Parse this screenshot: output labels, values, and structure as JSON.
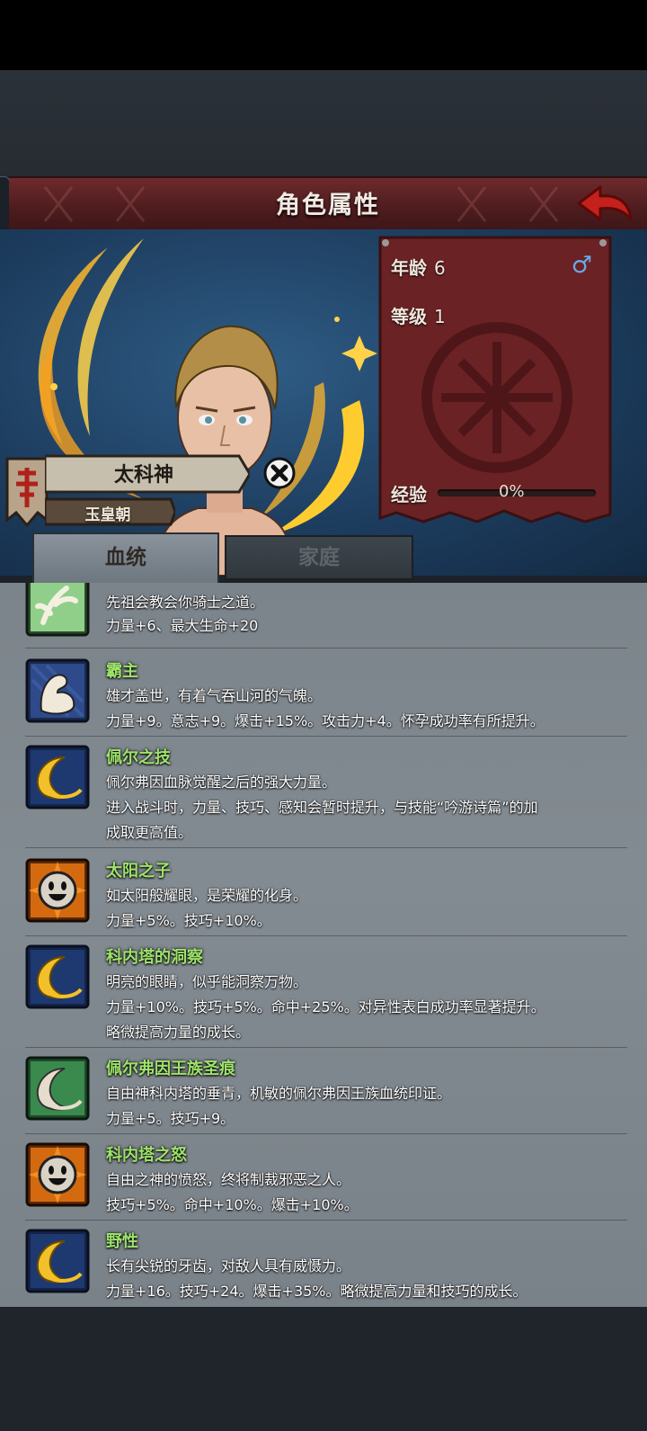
{
  "header": {
    "title": "角色属性"
  },
  "character": {
    "name": "太科神",
    "dynasty": "玉皇朝",
    "age_label": "年龄",
    "age": "6",
    "level_label": "等级",
    "level": "1",
    "gender_symbol": "♂",
    "xp_label": "经验",
    "xp_text": "0%",
    "xp_fraction": 0
  },
  "tabs": [
    {
      "label": "血统",
      "active": true
    },
    {
      "label": "家庭",
      "active": false
    }
  ],
  "traits": [
    {
      "name": "",
      "icon": "knight-leaf-icon",
      "lines": [
        "先祖会教会你骑士之道。",
        "力量+6、最大生命+20"
      ]
    },
    {
      "name": "霸主",
      "icon": "flexed-arm-icon",
      "lines": [
        "雄才盖世，有着气吞山河的气魄。",
        "力量+9。意志+9。爆击+15%。攻击力+4。怀孕成功率有所提升。"
      ]
    },
    {
      "name": "佩尔之技",
      "icon": "golden-crescent-icon",
      "lines": [
        "佩尔弗因血脉觉醒之后的强大力量。",
        "进入战斗时，力量、技巧、感知会暂时提升，与技能“吟游诗篇”的加",
        "成取更高值。"
      ]
    },
    {
      "name": "太阳之子",
      "icon": "smiling-sun-icon",
      "lines": [
        "如太阳般耀眼，是荣耀的化身。",
        "力量+5%。技巧+10%。"
      ]
    },
    {
      "name": "科内塔的洞察",
      "icon": "golden-crescent-icon",
      "lines": [
        "明亮的眼睛，似乎能洞察万物。",
        "力量+10%。技巧+5%。命中+25%。对异性表白成功率显著提升。",
        "略微提高力量的成长。"
      ]
    },
    {
      "name": "佩尔弗因王族圣痕",
      "icon": "silver-crescent-icon",
      "lines": [
        "自由神科内塔的垂青，机敏的佩尔弗因王族血统印证。",
        "力量+5。技巧+9。"
      ]
    },
    {
      "name": "科内塔之怒",
      "icon": "smiling-sun-icon",
      "lines": [
        "自由之神的愤怒，终将制裁邪恶之人。",
        "技巧+5%。命中+10%。爆击+10%。"
      ]
    },
    {
      "name": "野性",
      "icon": "golden-crescent-icon",
      "lines": [
        "长有尖锐的牙齿，对敌人具有威慑力。",
        "力量+16。技巧+24。爆击+35%。略微提高力量和技巧的成长。"
      ]
    }
  ]
}
